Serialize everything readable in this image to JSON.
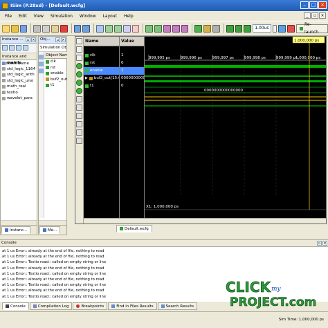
{
  "window": {
    "title": "ISim (P.28xd) - [Default.wcfg]"
  },
  "menu": {
    "items": [
      "File",
      "Edit",
      "View",
      "Simulation",
      "Window",
      "Layout",
      "Help"
    ]
  },
  "toolbar": {
    "time_value": "1.00us",
    "relaunch_label": "Re-launch"
  },
  "instance_panel": {
    "title": "Instance ...",
    "tab_label": "Instance and Process Name",
    "items": [
      "mainls",
      "std_logic_1164",
      "std_logic_arith",
      "std_logic_unsi",
      "math_real",
      "textio",
      "wavelet_para"
    ],
    "tab": "Instanc..."
  },
  "object_panel": {
    "title": "Obj...",
    "subtitle": "Simulation Object...",
    "column": "Object Name",
    "items": [
      "clk",
      "rst",
      "enable",
      "buf2_out[1",
      "t1"
    ],
    "tab": "Me..."
  },
  "wave": {
    "name_header": "Name",
    "value_header": "Value",
    "cursor_label": "1,000,000 ps",
    "time_labels": [
      "999,995 ps",
      "999,996 ps",
      "999,997 ps",
      "999,998 ps",
      "999,999 ps",
      "1,000,000 ps"
    ],
    "signals": [
      {
        "name": "clk",
        "value": "1"
      },
      {
        "name": "rst",
        "value": "0"
      },
      {
        "name": "enable",
        "value": "1"
      },
      {
        "name": "buf2_out[15:0]",
        "value": "00000000000000"
      },
      {
        "name": "t1",
        "value": "0"
      }
    ],
    "bus_value": "0000000000000000",
    "x_readout": "X1: 1,000,000 ps",
    "tab_label": "Default.wcfg"
  },
  "console": {
    "title": "Console",
    "lines": [
      "at 1 us Error:: already at the end of file, nothing to read",
      "at 1 us Error:: already at the end of file, nothing to read",
      "at 1 us Error:: Textio read:: called on empty string or line",
      "at 1 us Error:: already at the end of file, nothing to read",
      "at 1 us Error:: Textio read:: called on empty string or line",
      "at 1 us Error:: already at the end of file, nothing to read",
      "at 1 us Error:: Textio read:: called on empty string or line",
      "at 1 us Error:: already at the end of file, nothing to read",
      "at 1 us Error:: Textio read:: called on empty string or line"
    ]
  },
  "bottom_tabs": [
    "Console",
    "Compilation Log",
    "Breakpoints",
    "Find in Files Results",
    "Search Results"
  ],
  "status": {
    "sim_time": "Sim Time: 1,000,000 ps"
  },
  "watermark": {
    "line1": "CLICK",
    "line2": "PROJECT.com",
    "mid": "my"
  },
  "colors": {
    "signal_green": "#00c000",
    "bus_gold": "#c8a000",
    "cursor": "#e8c000"
  }
}
